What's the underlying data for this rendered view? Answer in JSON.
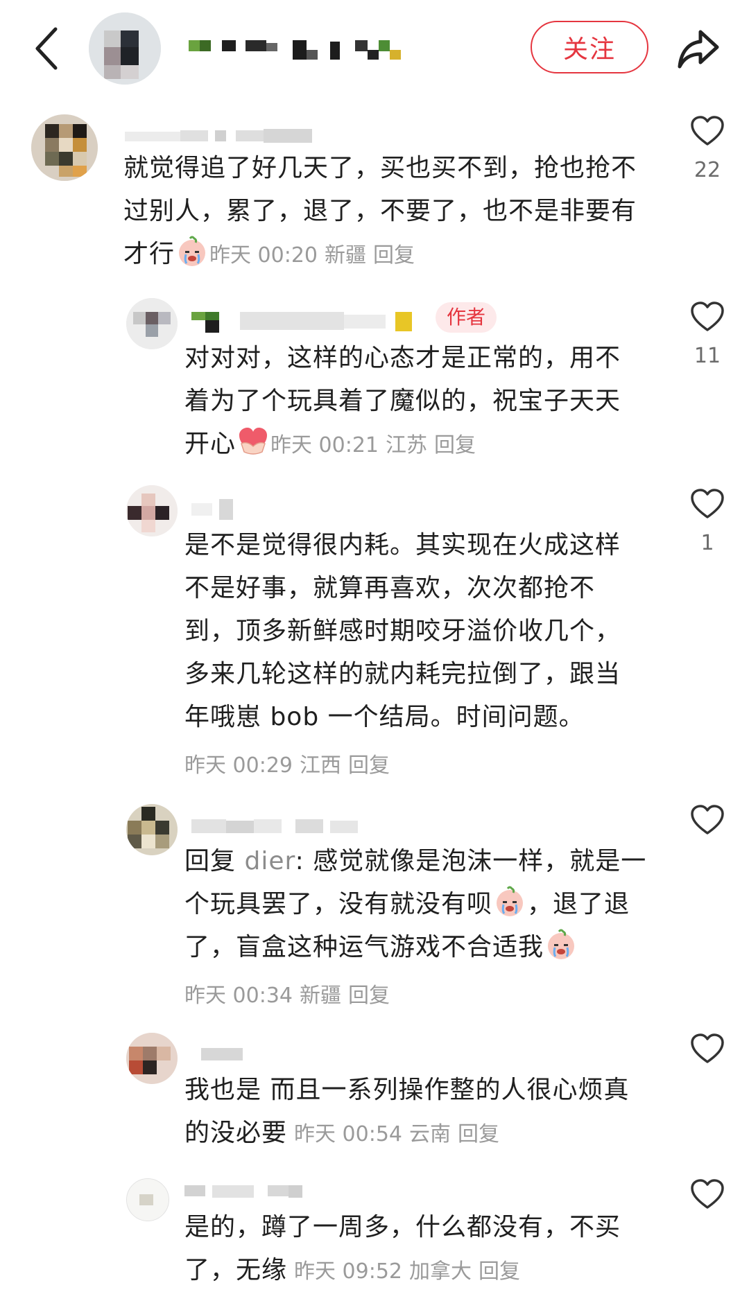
{
  "header": {
    "follow_label": "关注"
  },
  "comments": [
    {
      "text": "就觉得追了好几天了，买也买不到，抢也抢不过别人，累了，退了，不要了，也不是非要有才行",
      "time": "昨天 00:20",
      "location": "新疆",
      "reply_label": "回复",
      "likes": "22"
    },
    {
      "badge": "作者",
      "text": "对对对，这样的心态才是正常的，用不着为了个玩具着了魔似的，祝宝子天天开心",
      "time": "昨天 00:21",
      "location": "江苏",
      "reply_label": "回复",
      "likes": "11"
    },
    {
      "text": "是不是觉得很内耗。其实现在火成这样不是好事，就算再喜欢，次次都抢不到，顶多新鲜感时期咬牙溢价收几个，多来几轮这样的就内耗完拉倒了，跟当年哦崽 bob 一个结局。时间问题。",
      "time": "昨天 00:29",
      "location": "江西",
      "reply_label": "回复",
      "likes": "1"
    },
    {
      "reply_prefix": "回复",
      "reply_to": "dier",
      "text_a": ": 感觉就像是泡沫一样，就是一个玩具罢了，没有就没有呗",
      "text_b": "，退了退了，盲盒这种运气游戏不合适我",
      "time": "昨天 00:34",
      "location": "新疆",
      "reply_label": "回复",
      "likes": ""
    },
    {
      "text": "我也是 而且一系列操作整的人很心烦真的没必要",
      "time": "昨天 00:54",
      "location": "云南",
      "reply_label": "回复",
      "likes": ""
    },
    {
      "text": "是的，蹲了一周多，什么都没有，不买了，无缘",
      "time": "昨天 09:52",
      "location": "加拿大",
      "reply_label": "回复",
      "likes": ""
    }
  ],
  "colors": {
    "accent_red": "#e5353f",
    "meta_gray": "#9a9a9a",
    "text_dark": "#1f1f1f"
  },
  "icons": [
    "back-arrow-icon",
    "share-icon",
    "heart-icon",
    "crying-face-emoji",
    "heart-hands-emoji"
  ]
}
